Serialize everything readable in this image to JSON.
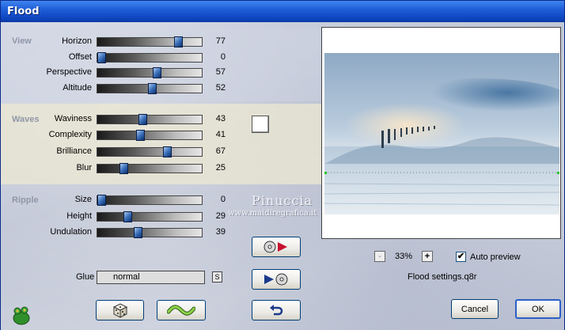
{
  "window": {
    "title": "Flood"
  },
  "sections": {
    "view": "View",
    "waves": "Waves",
    "ripple": "Ripple"
  },
  "sliders": {
    "horizon": {
      "label": "Horizon",
      "value": "77",
      "fraction": 0.77
    },
    "offset": {
      "label": "Offset",
      "value": "0",
      "fraction": 0.0
    },
    "perspective": {
      "label": "Perspective",
      "value": "57",
      "fraction": 0.57
    },
    "altitude": {
      "label": "Altitude",
      "value": "52",
      "fraction": 0.52
    },
    "waviness": {
      "label": "Waviness",
      "value": "43",
      "fraction": 0.43
    },
    "complexity": {
      "label": "Complexity",
      "value": "41",
      "fraction": 0.41
    },
    "brilliance": {
      "label": "Brilliance",
      "value": "67",
      "fraction": 0.67
    },
    "blur": {
      "label": "Blur",
      "value": "25",
      "fraction": 0.25
    },
    "size": {
      "label": "Size",
      "value": "0",
      "fraction": 0.0
    },
    "height": {
      "label": "Height",
      "value": "29",
      "fraction": 0.29
    },
    "undulation": {
      "label": "Undulation",
      "value": "39",
      "fraction": 0.39
    }
  },
  "color_swatch": "#ffffff",
  "watermark": {
    "name": "Pinuccia",
    "url": "www.maidiregrafica.it"
  },
  "glue": {
    "label": "Glue",
    "value": "normal",
    "lock_label": "S"
  },
  "zoom": {
    "minus": "-",
    "value": "33%",
    "plus": "+"
  },
  "auto_preview": {
    "label": "Auto preview",
    "checked": true,
    "mark": "✔"
  },
  "settings_file": "Flood settings.q8r",
  "buttons": {
    "cancel": "Cancel",
    "ok": "OK"
  },
  "icons": {
    "random": "dice-icon",
    "reset_wave": "wave-icon",
    "save_preset": "disc-save-icon",
    "load_preset": "disc-load-icon",
    "undo": "undo-arrow-icon",
    "logo": "frog-logo-icon"
  }
}
